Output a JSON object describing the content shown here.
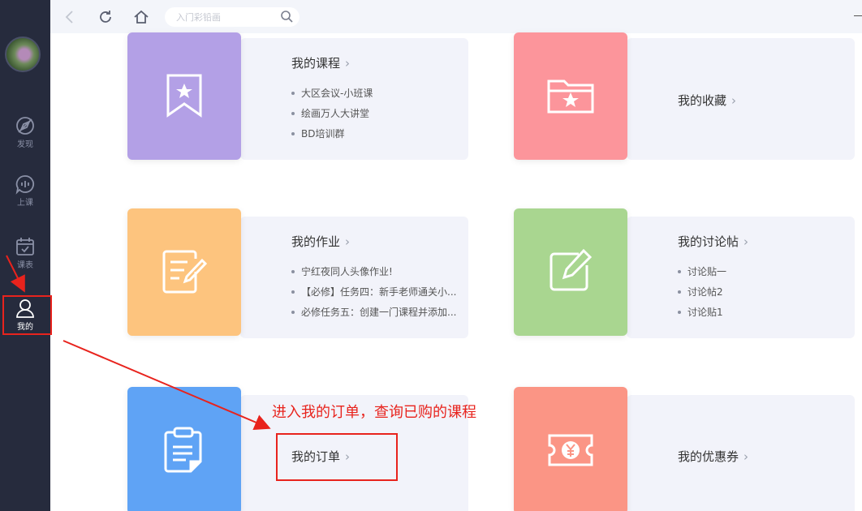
{
  "sidebar": {
    "items": [
      {
        "label": "发现",
        "icon": "compass-icon"
      },
      {
        "label": "上课",
        "icon": "live-class-icon"
      },
      {
        "label": "课表",
        "icon": "calendar-check-icon"
      },
      {
        "label": "我的",
        "icon": "user-icon",
        "active": true
      }
    ]
  },
  "topbar": {
    "search_placeholder": "入门彩铅画"
  },
  "cards": {
    "courses": {
      "title": "我的课程",
      "items": [
        "大区会议-小班课",
        "绘画万人大讲堂",
        "BD培训群"
      ],
      "color": "#b3a0e6"
    },
    "favorites": {
      "title": "我的收藏",
      "color": "#fc959b"
    },
    "homework": {
      "title": "我的作业",
      "items": [
        "宁红夜同人头像作业!",
        "【必修】任务四：新手老师通关小...",
        "必修任务五：创建一门课程并添加..."
      ],
      "color": "#fdc47e"
    },
    "discussions": {
      "title": "我的讨论帖",
      "items": [
        "讨论贴一",
        "讨论帖2",
        "讨论贴1"
      ],
      "color": "#a9d690"
    },
    "orders": {
      "title": "我的订单",
      "color": "#5fa3f5"
    },
    "coupons": {
      "title": "我的优惠券",
      "color": "#fb9585"
    }
  },
  "annotation": {
    "text": "进入我的订单，查询已购的课程",
    "color": "#e8231d"
  }
}
